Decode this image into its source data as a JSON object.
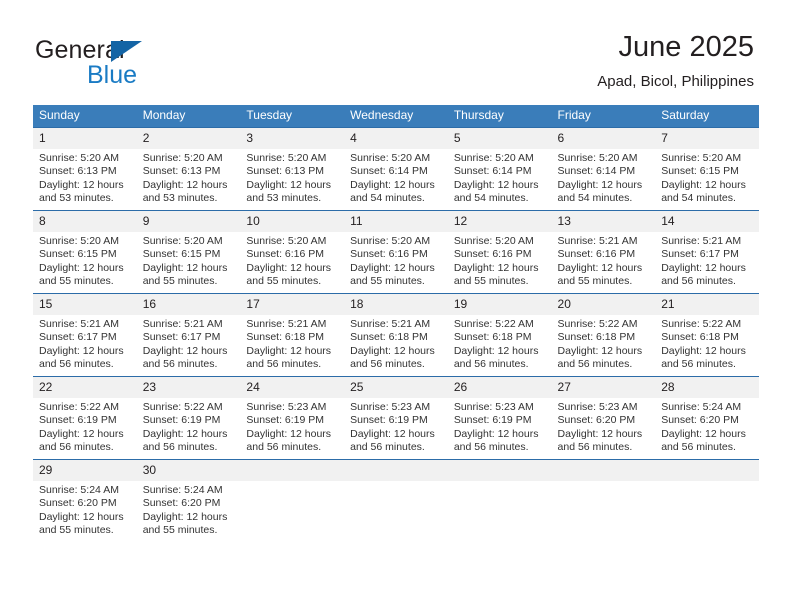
{
  "brand": {
    "name_part1": "General",
    "name_part2": "Blue",
    "triangle_color": "#1464a5",
    "blue_color": "#1a7bc4"
  },
  "header": {
    "title": "June 2025",
    "subtitle": "Apad, Bicol, Philippines",
    "header_bg": "#3a7dba",
    "row_border_color": "#2c6ca8",
    "daynum_bg": "#f1f1f1"
  },
  "weekday_headers": [
    "Sunday",
    "Monday",
    "Tuesday",
    "Wednesday",
    "Thursday",
    "Friday",
    "Saturday"
  ],
  "weeks": [
    [
      {
        "day": "1",
        "sunrise": "Sunrise: 5:20 AM",
        "sunset": "Sunset: 6:13 PM",
        "daylight_l1": "Daylight: 12 hours",
        "daylight_l2": "and 53 minutes."
      },
      {
        "day": "2",
        "sunrise": "Sunrise: 5:20 AM",
        "sunset": "Sunset: 6:13 PM",
        "daylight_l1": "Daylight: 12 hours",
        "daylight_l2": "and 53 minutes."
      },
      {
        "day": "3",
        "sunrise": "Sunrise: 5:20 AM",
        "sunset": "Sunset: 6:13 PM",
        "daylight_l1": "Daylight: 12 hours",
        "daylight_l2": "and 53 minutes."
      },
      {
        "day": "4",
        "sunrise": "Sunrise: 5:20 AM",
        "sunset": "Sunset: 6:14 PM",
        "daylight_l1": "Daylight: 12 hours",
        "daylight_l2": "and 54 minutes."
      },
      {
        "day": "5",
        "sunrise": "Sunrise: 5:20 AM",
        "sunset": "Sunset: 6:14 PM",
        "daylight_l1": "Daylight: 12 hours",
        "daylight_l2": "and 54 minutes."
      },
      {
        "day": "6",
        "sunrise": "Sunrise: 5:20 AM",
        "sunset": "Sunset: 6:14 PM",
        "daylight_l1": "Daylight: 12 hours",
        "daylight_l2": "and 54 minutes."
      },
      {
        "day": "7",
        "sunrise": "Sunrise: 5:20 AM",
        "sunset": "Sunset: 6:15 PM",
        "daylight_l1": "Daylight: 12 hours",
        "daylight_l2": "and 54 minutes."
      }
    ],
    [
      {
        "day": "8",
        "sunrise": "Sunrise: 5:20 AM",
        "sunset": "Sunset: 6:15 PM",
        "daylight_l1": "Daylight: 12 hours",
        "daylight_l2": "and 55 minutes."
      },
      {
        "day": "9",
        "sunrise": "Sunrise: 5:20 AM",
        "sunset": "Sunset: 6:15 PM",
        "daylight_l1": "Daylight: 12 hours",
        "daylight_l2": "and 55 minutes."
      },
      {
        "day": "10",
        "sunrise": "Sunrise: 5:20 AM",
        "sunset": "Sunset: 6:16 PM",
        "daylight_l1": "Daylight: 12 hours",
        "daylight_l2": "and 55 minutes."
      },
      {
        "day": "11",
        "sunrise": "Sunrise: 5:20 AM",
        "sunset": "Sunset: 6:16 PM",
        "daylight_l1": "Daylight: 12 hours",
        "daylight_l2": "and 55 minutes."
      },
      {
        "day": "12",
        "sunrise": "Sunrise: 5:20 AM",
        "sunset": "Sunset: 6:16 PM",
        "daylight_l1": "Daylight: 12 hours",
        "daylight_l2": "and 55 minutes."
      },
      {
        "day": "13",
        "sunrise": "Sunrise: 5:21 AM",
        "sunset": "Sunset: 6:16 PM",
        "daylight_l1": "Daylight: 12 hours",
        "daylight_l2": "and 55 minutes."
      },
      {
        "day": "14",
        "sunrise": "Sunrise: 5:21 AM",
        "sunset": "Sunset: 6:17 PM",
        "daylight_l1": "Daylight: 12 hours",
        "daylight_l2": "and 56 minutes."
      }
    ],
    [
      {
        "day": "15",
        "sunrise": "Sunrise: 5:21 AM",
        "sunset": "Sunset: 6:17 PM",
        "daylight_l1": "Daylight: 12 hours",
        "daylight_l2": "and 56 minutes."
      },
      {
        "day": "16",
        "sunrise": "Sunrise: 5:21 AM",
        "sunset": "Sunset: 6:17 PM",
        "daylight_l1": "Daylight: 12 hours",
        "daylight_l2": "and 56 minutes."
      },
      {
        "day": "17",
        "sunrise": "Sunrise: 5:21 AM",
        "sunset": "Sunset: 6:18 PM",
        "daylight_l1": "Daylight: 12 hours",
        "daylight_l2": "and 56 minutes."
      },
      {
        "day": "18",
        "sunrise": "Sunrise: 5:21 AM",
        "sunset": "Sunset: 6:18 PM",
        "daylight_l1": "Daylight: 12 hours",
        "daylight_l2": "and 56 minutes."
      },
      {
        "day": "19",
        "sunrise": "Sunrise: 5:22 AM",
        "sunset": "Sunset: 6:18 PM",
        "daylight_l1": "Daylight: 12 hours",
        "daylight_l2": "and 56 minutes."
      },
      {
        "day": "20",
        "sunrise": "Sunrise: 5:22 AM",
        "sunset": "Sunset: 6:18 PM",
        "daylight_l1": "Daylight: 12 hours",
        "daylight_l2": "and 56 minutes."
      },
      {
        "day": "21",
        "sunrise": "Sunrise: 5:22 AM",
        "sunset": "Sunset: 6:18 PM",
        "daylight_l1": "Daylight: 12 hours",
        "daylight_l2": "and 56 minutes."
      }
    ],
    [
      {
        "day": "22",
        "sunrise": "Sunrise: 5:22 AM",
        "sunset": "Sunset: 6:19 PM",
        "daylight_l1": "Daylight: 12 hours",
        "daylight_l2": "and 56 minutes."
      },
      {
        "day": "23",
        "sunrise": "Sunrise: 5:22 AM",
        "sunset": "Sunset: 6:19 PM",
        "daylight_l1": "Daylight: 12 hours",
        "daylight_l2": "and 56 minutes."
      },
      {
        "day": "24",
        "sunrise": "Sunrise: 5:23 AM",
        "sunset": "Sunset: 6:19 PM",
        "daylight_l1": "Daylight: 12 hours",
        "daylight_l2": "and 56 minutes."
      },
      {
        "day": "25",
        "sunrise": "Sunrise: 5:23 AM",
        "sunset": "Sunset: 6:19 PM",
        "daylight_l1": "Daylight: 12 hours",
        "daylight_l2": "and 56 minutes."
      },
      {
        "day": "26",
        "sunrise": "Sunrise: 5:23 AM",
        "sunset": "Sunset: 6:19 PM",
        "daylight_l1": "Daylight: 12 hours",
        "daylight_l2": "and 56 minutes."
      },
      {
        "day": "27",
        "sunrise": "Sunrise: 5:23 AM",
        "sunset": "Sunset: 6:20 PM",
        "daylight_l1": "Daylight: 12 hours",
        "daylight_l2": "and 56 minutes."
      },
      {
        "day": "28",
        "sunrise": "Sunrise: 5:24 AM",
        "sunset": "Sunset: 6:20 PM",
        "daylight_l1": "Daylight: 12 hours",
        "daylight_l2": "and 56 minutes."
      }
    ],
    [
      {
        "day": "29",
        "sunrise": "Sunrise: 5:24 AM",
        "sunset": "Sunset: 6:20 PM",
        "daylight_l1": "Daylight: 12 hours",
        "daylight_l2": "and 55 minutes."
      },
      {
        "day": "30",
        "sunrise": "Sunrise: 5:24 AM",
        "sunset": "Sunset: 6:20 PM",
        "daylight_l1": "Daylight: 12 hours",
        "daylight_l2": "and 55 minutes."
      },
      {
        "day": "",
        "sunrise": "",
        "sunset": "",
        "daylight_l1": "",
        "daylight_l2": ""
      },
      {
        "day": "",
        "sunrise": "",
        "sunset": "",
        "daylight_l1": "",
        "daylight_l2": ""
      },
      {
        "day": "",
        "sunrise": "",
        "sunset": "",
        "daylight_l1": "",
        "daylight_l2": ""
      },
      {
        "day": "",
        "sunrise": "",
        "sunset": "",
        "daylight_l1": "",
        "daylight_l2": ""
      },
      {
        "day": "",
        "sunrise": "",
        "sunset": "",
        "daylight_l1": "",
        "daylight_l2": ""
      }
    ]
  ]
}
